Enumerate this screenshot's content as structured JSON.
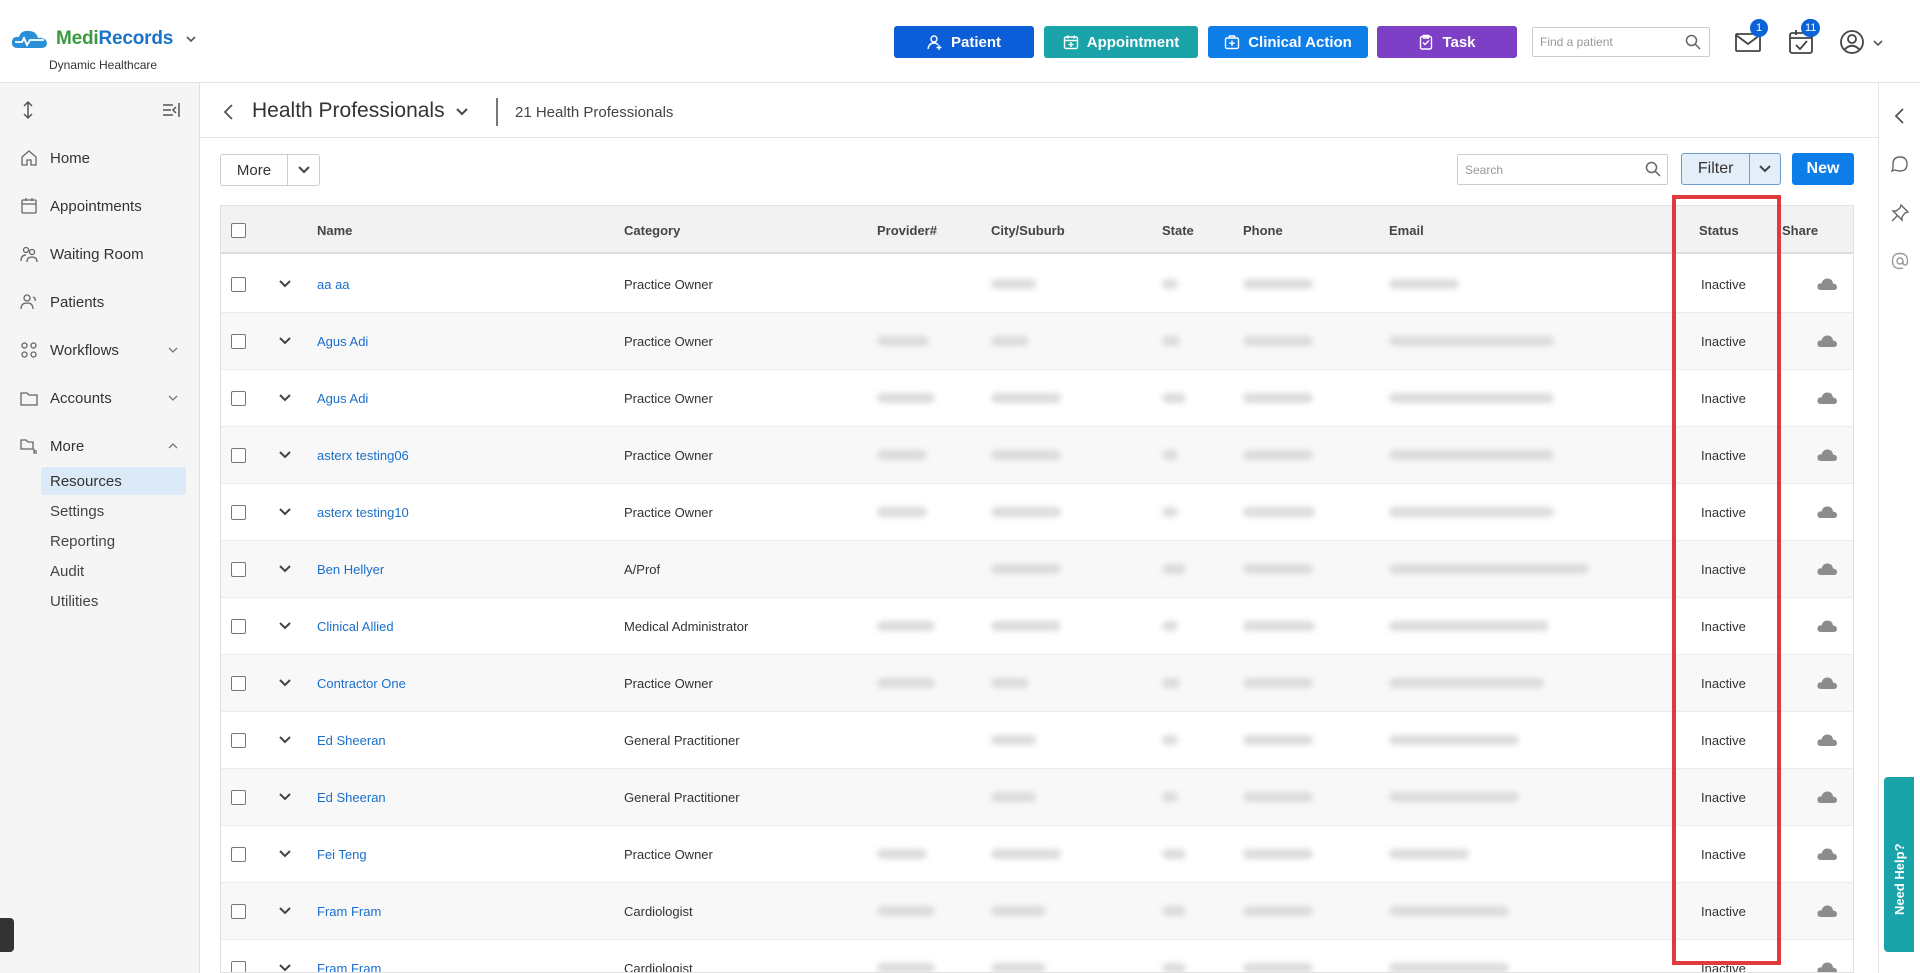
{
  "header": {
    "brand_a": "Medi",
    "brand_b": "Records",
    "org": "Dynamic Healthcare",
    "buttons": {
      "patient": "Patient",
      "appointment": "Appointment",
      "clinical_action": "Clinical Action",
      "task": "Task"
    },
    "find_placeholder": "Find a patient",
    "mail_count": "1",
    "calendar_count": "11",
    "colors": {
      "patient": "#0b5ed7",
      "appointment": "#1aa3a8",
      "clinical_action": "#0d7de8",
      "task": "#7c3fc6"
    }
  },
  "sidebar": {
    "items": [
      {
        "label": "Home",
        "icon": "home-icon"
      },
      {
        "label": "Appointments",
        "icon": "calendar-icon"
      },
      {
        "label": "Waiting Room",
        "icon": "people-icon"
      },
      {
        "label": "Patients",
        "icon": "person-icon"
      },
      {
        "label": "Workflows",
        "icon": "workflow-icon"
      },
      {
        "label": "Accounts",
        "icon": "folder-icon"
      },
      {
        "label": "More",
        "icon": "folder-tree-icon"
      }
    ],
    "subitems": [
      "Resources",
      "Settings",
      "Reporting",
      "Audit",
      "Utilities"
    ],
    "active_subitem": "Resources"
  },
  "page": {
    "title": "Health Professionals",
    "count": "21 Health Professionals",
    "more_label": "More",
    "search_placeholder": "Search",
    "filter_label": "Filter",
    "new_label": "New"
  },
  "table": {
    "columns": [
      "Name",
      "Category",
      "Provider#",
      "City/Suburb",
      "State",
      "Phone",
      "Email",
      "Status",
      "Share"
    ],
    "rows": [
      {
        "name": "aa aa",
        "category": "Practice Owner",
        "status": "Inactive"
      },
      {
        "name": "Agus Adi",
        "category": "Practice Owner",
        "status": "Inactive"
      },
      {
        "name": "Agus Adi",
        "category": "Practice Owner",
        "status": "Inactive"
      },
      {
        "name": "asterx testing06",
        "category": "Practice Owner",
        "status": "Inactive"
      },
      {
        "name": "asterx testing10",
        "category": "Practice Owner",
        "status": "Inactive"
      },
      {
        "name": "Ben Hellyer",
        "category": "A/Prof",
        "status": "Inactive"
      },
      {
        "name": "Clinical Allied",
        "category": "Medical Administrator",
        "status": "Inactive"
      },
      {
        "name": "Contractor One",
        "category": "Practice Owner",
        "status": "Inactive"
      },
      {
        "name": "Ed Sheeran",
        "category": "General Practitioner",
        "status": "Inactive"
      },
      {
        "name": "Ed Sheeran",
        "category": "General Practitioner",
        "status": "Inactive"
      },
      {
        "name": "Fei Teng",
        "category": "Practice Owner",
        "status": "Inactive"
      },
      {
        "name": "Fram Fram",
        "category": "Cardiologist",
        "status": "Inactive"
      },
      {
        "name": "Fram Fram",
        "category": "Cardiologist",
        "status": "Inactive"
      }
    ]
  },
  "help_tab": "Need Help?"
}
